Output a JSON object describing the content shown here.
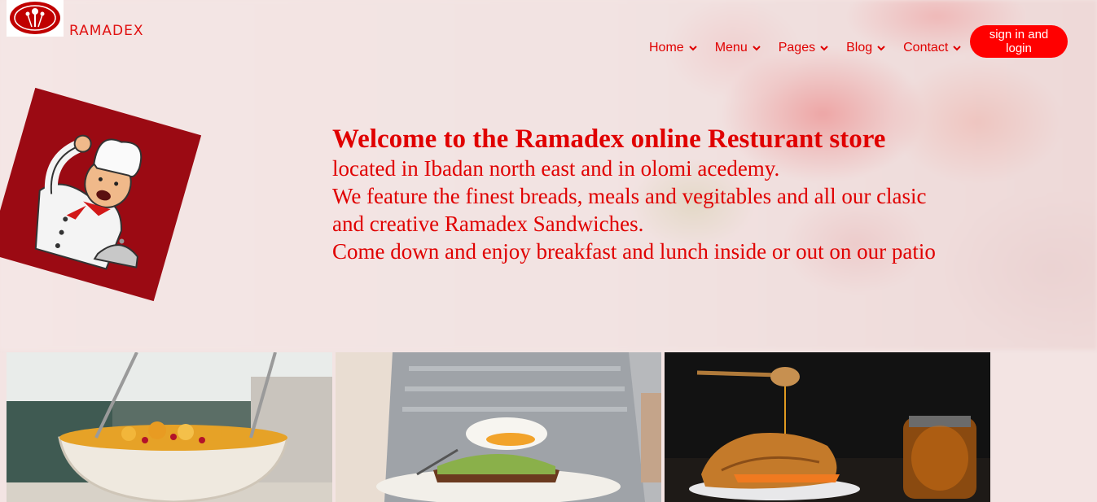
{
  "brand": {
    "name": "RAMADEX"
  },
  "nav": {
    "items": [
      {
        "label": "Home"
      },
      {
        "label": "Menu"
      },
      {
        "label": "Pages"
      },
      {
        "label": "Blog"
      },
      {
        "label": "Contact"
      }
    ],
    "signin_label": "sign in and login"
  },
  "hero": {
    "title": "Welcome to the Ramadex online Resturant store",
    "lines": [
      "located in Ibadan north east and in olomi acedemy.",
      "We feature the finest breads, meals and vegitables and all our clasic",
      "and creative Ramadex Sandwiches.",
      "Come down and enjoy breakfast and lunch inside or out on our patio"
    ]
  },
  "colors": {
    "accent": "#ff0000",
    "text": "#e00000",
    "chef_bg": "#9b0a13"
  },
  "gallery": [
    {
      "icon": "fruit-bowl-photo"
    },
    {
      "icon": "avocado-toast-photo"
    },
    {
      "icon": "croissant-honey-photo"
    }
  ]
}
